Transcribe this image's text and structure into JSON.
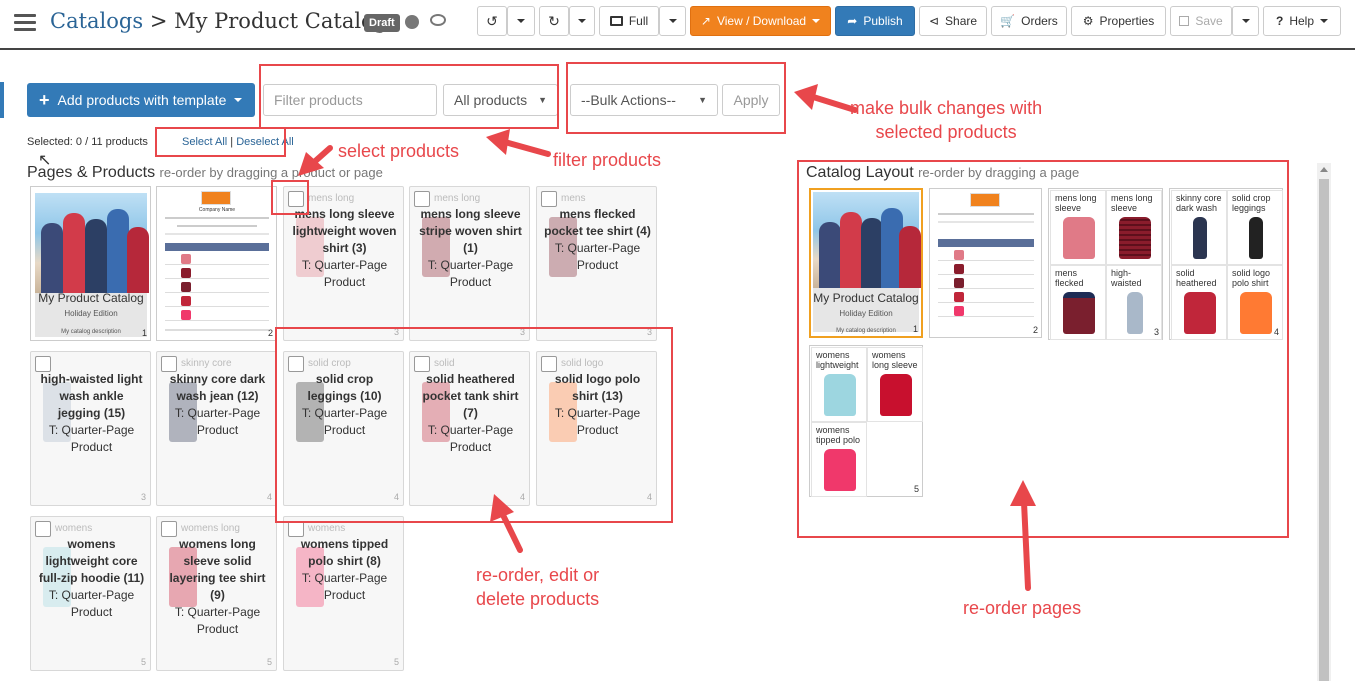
{
  "header": {
    "breadcrumb_root": "Catalogs",
    "breadcrumb_sep": " > ",
    "breadcrumb_current": "My Product Catalog",
    "draft_badge": "Draft",
    "view_mode": "Full",
    "view_download": "View / Download",
    "publish": "Publish",
    "share": "Share",
    "orders": "Orders",
    "properties": "Properties",
    "save": "Save",
    "help": "Help"
  },
  "toolbar": {
    "add_products": "Add products with template",
    "filter_placeholder": "Filter products",
    "filter_select": "All products",
    "bulk_actions": "--Bulk Actions--",
    "apply": "Apply"
  },
  "selection": {
    "count": "Selected: 0 / 11 products",
    "select_all": "Select All",
    "sep": " | ",
    "deselect_all": "Deselect All"
  },
  "pages_products": {
    "title": "Pages & Products",
    "hint": "re-order by dragging a product or page",
    "cover": {
      "title": "My Product Catalog",
      "subtitle": "Holiday Edition",
      "desc": "My catalog description",
      "page": "1"
    },
    "form": {
      "company": "Company Name",
      "page": "2"
    },
    "products": [
      {
        "name": "mens long sleeve lightweight woven shirt (3)",
        "template": "T: Quarter-Page Product",
        "page": "3",
        "ghost": "mens long",
        "color": "#e07a87"
      },
      {
        "name": "mens long sleeve stripe woven shirt (1)",
        "template": "T: Quarter-Page Product",
        "page": "3",
        "ghost": "mens long",
        "color": "#8a1c2c"
      },
      {
        "name": "mens flecked pocket tee shirt (4)",
        "template": "T: Quarter-Page Product",
        "page": "3",
        "ghost": "mens",
        "color": "#7a1f2e"
      },
      {
        "name": "high-waisted light wash ankle jegging (15)",
        "template": "T: Quarter-Page Product",
        "page": "3",
        "ghost": "",
        "color": "#a9b8c9"
      },
      {
        "name": "skinny core dark wash jean (12)",
        "template": "T: Quarter-Page Product",
        "page": "4",
        "ghost": "skinny core",
        "color": "#2b3550"
      },
      {
        "name": "solid crop leggings (10)",
        "template": "T: Quarter-Page Product",
        "page": "4",
        "ghost": "solid crop",
        "color": "#333"
      },
      {
        "name": "solid heathered pocket tank shirt (7)",
        "template": "T: Quarter-Page Product",
        "page": "4",
        "ghost": "solid",
        "color": "#c0263a"
      },
      {
        "name": "solid logo polo shirt (13)",
        "template": "T: Quarter-Page Product",
        "page": "4",
        "ghost": "solid logo",
        "color": "#ff7a33"
      },
      {
        "name": "womens lightweight core full-zip hoodie (11)",
        "template": "T: Quarter-Page Product",
        "page": "5",
        "ghost": "womens",
        "color": "#9dd6e0"
      },
      {
        "name": "womens long sleeve solid layering tee shirt (9)",
        "template": "T: Quarter-Page Product",
        "page": "5",
        "ghost": "womens long",
        "color": "#c8102e"
      },
      {
        "name": "womens tipped polo shirt (8)",
        "template": "T: Quarter-Page Product",
        "page": "5",
        "ghost": "womens",
        "color": "#f0386b"
      }
    ]
  },
  "layout": {
    "title": "Catalog Layout",
    "hint": "re-order by dragging a page",
    "page3": [
      "mens long sleeve",
      "mens long sleeve",
      "mens flecked",
      "high-waisted"
    ],
    "page4": [
      "skinny core dark wash",
      "solid crop leggings",
      "solid heathered",
      "solid logo polo shirt"
    ],
    "page5": [
      "womens lightweight",
      "womens long sleeve",
      "womens tipped polo"
    ]
  },
  "annotations": {
    "bulk": "make bulk changes with\nselected products",
    "select": "select products",
    "filter": "filter products",
    "reorder_products": "re-order, edit or\ndelete products",
    "reorder_pages": "re-order pages"
  },
  "colors": {
    "accent": "#337ab7",
    "orange": "#f0821e",
    "annotation": "#e8474b"
  }
}
